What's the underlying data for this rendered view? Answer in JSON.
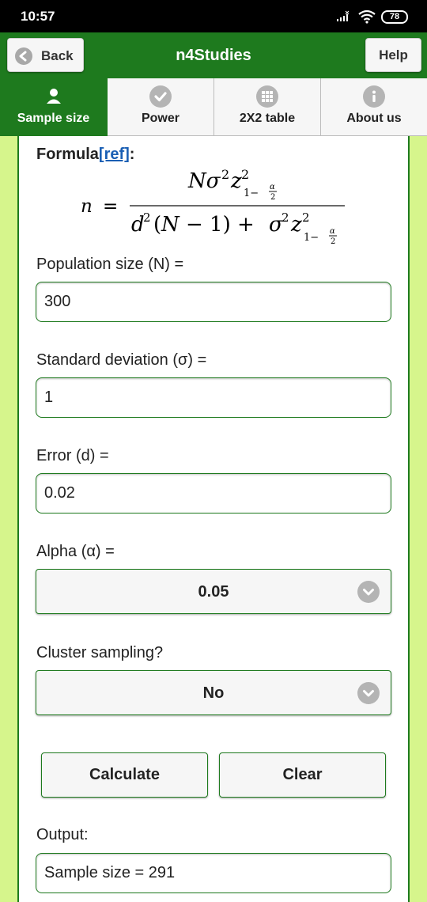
{
  "status_bar": {
    "time": "10:57",
    "battery": "78"
  },
  "header": {
    "back_label": "Back",
    "title": "n4Studies",
    "help_label": "Help"
  },
  "tabs": [
    {
      "label": "Sample size",
      "icon": "user-icon",
      "active": true
    },
    {
      "label": "Power",
      "icon": "check-icon",
      "active": false
    },
    {
      "label": "2X2 table",
      "icon": "grid-icon",
      "active": false
    },
    {
      "label": "About us",
      "icon": "info-icon",
      "active": false
    }
  ],
  "formula": {
    "label": "Formula",
    "ref_link": "[ref]",
    "colon": ":"
  },
  "fields": {
    "population": {
      "label": "Population size (N) =",
      "value": "300"
    },
    "sd": {
      "label": "Standard deviation (σ) =",
      "value": "1"
    },
    "error": {
      "label": "Error (d) =",
      "value": "0.02"
    },
    "alpha": {
      "label": "Alpha (α) =",
      "value": "0.05"
    },
    "cluster": {
      "label": "Cluster sampling?",
      "value": "No"
    }
  },
  "buttons": {
    "calculate": "Calculate",
    "clear": "Clear"
  },
  "output": {
    "label": "Output:",
    "value": "Sample size = 291"
  },
  "colors": {
    "header_green": "#1e7a1e",
    "background_lime": "#d6f58c",
    "link_blue": "#1a5fb4"
  }
}
